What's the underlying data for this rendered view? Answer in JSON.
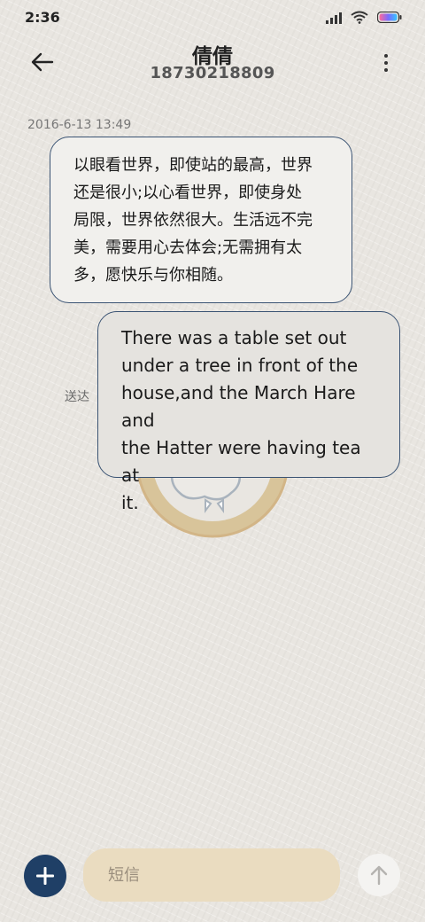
{
  "status_bar": {
    "time": "2:36",
    "battery_gradient": [
      "#ff6a9a",
      "#7a6bff",
      "#34c7ff"
    ]
  },
  "header": {
    "contact_name": "倩倩",
    "phone_number": "18730218809",
    "back_icon": "arrow-left-icon",
    "menu_icon": "more-vertical-icon"
  },
  "conversation": {
    "timestamp": "2016-6-13 13:49",
    "messages": [
      {
        "direction": "received",
        "lines": [
          "以眼看世界，即使站的最高，世界",
          "还是很小;以心看世界，即使身处",
          "局限，世界依然很大。生活远不完",
          "美，需要用心去体会;无需拥有太",
          "多，愿快乐与你相随。"
        ]
      },
      {
        "direction": "sent",
        "status": "送达",
        "lines": [
          "There was a table set out",
          "under a tree in front of the",
          "house,and the March Hare and",
          "the Hatter were having tea at",
          "it."
        ]
      }
    ]
  },
  "composer": {
    "add_icon": "plus-icon",
    "placeholder": "短信",
    "value": "",
    "send_icon": "arrow-up-icon"
  },
  "colors": {
    "accent": "#1f3f66",
    "bubble_border": "#3a5373",
    "input_background": "#eadcc0"
  }
}
